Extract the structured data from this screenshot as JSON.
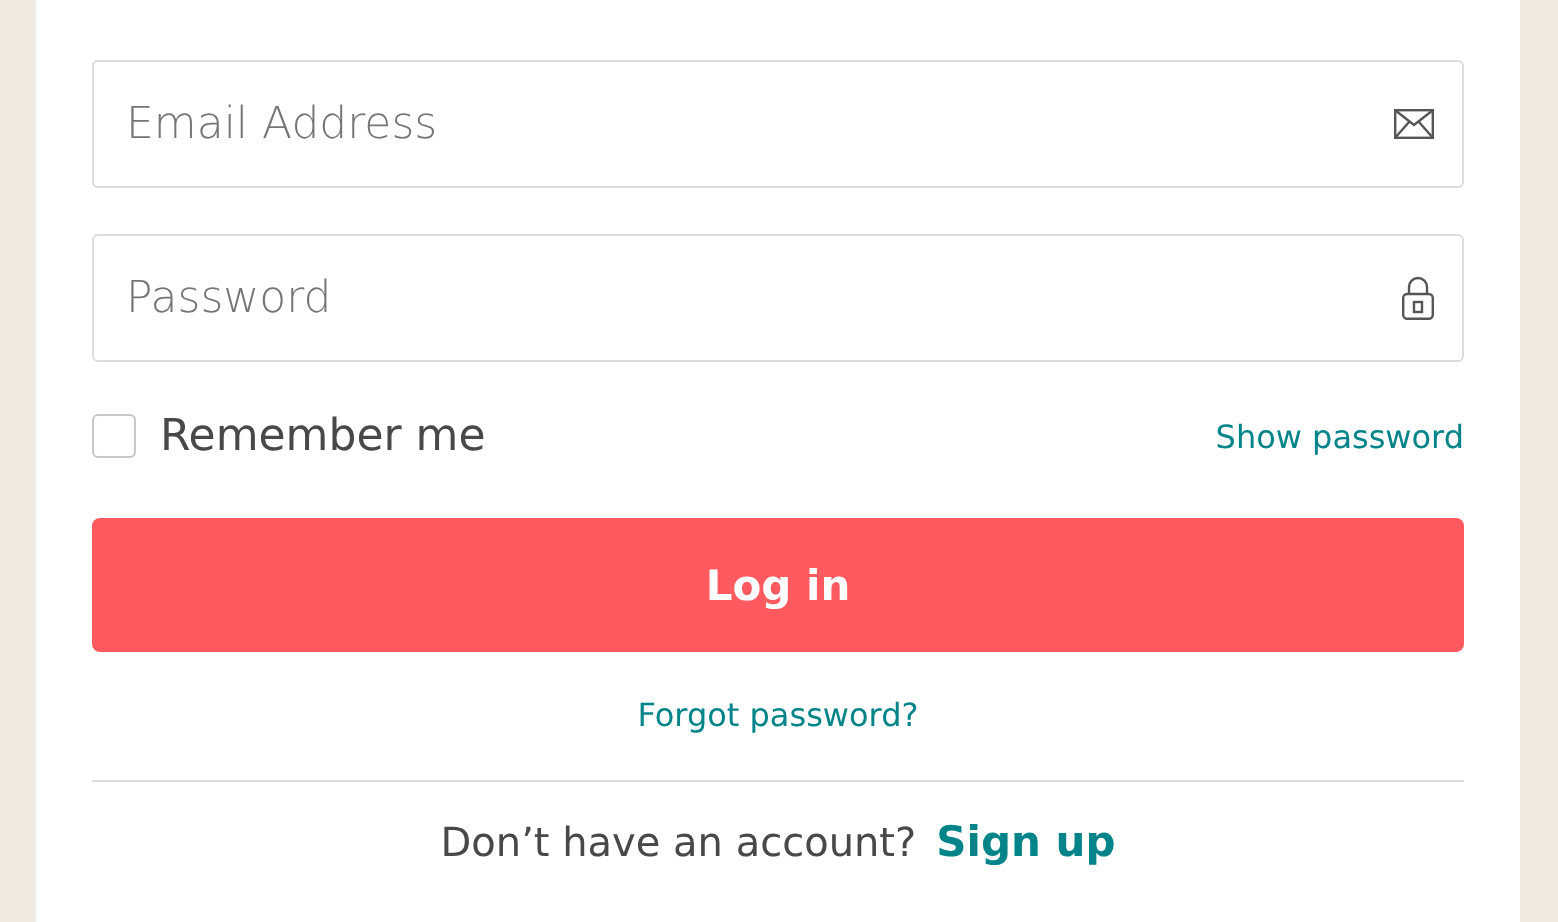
{
  "email_field": {
    "placeholder": "Email Address"
  },
  "password_field": {
    "placeholder": "Password"
  },
  "remember_me": {
    "label": "Remember me",
    "checked": false
  },
  "show_password_link": "Show password",
  "login_button": "Log in",
  "forgot_password_link": "Forgot password?",
  "signup_prompt": {
    "text": "Don’t have an account?",
    "link": "Sign up"
  }
}
